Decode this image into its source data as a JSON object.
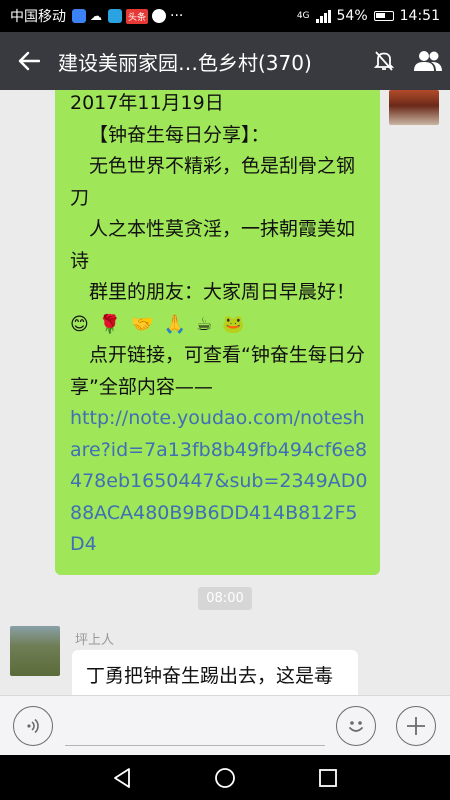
{
  "status_bar": {
    "carrier": "中国移动",
    "network": "4G",
    "battery": "54%",
    "time": "14:51",
    "more": "···",
    "app_badge": "头条"
  },
  "title_bar": {
    "title": "建设美丽家园…色乡村(370)"
  },
  "messages": {
    "my_message": {
      "date_line": "2017年11月19日",
      "heading": "【钟奋生每日分享】：",
      "poem_line1": "无色世界不精彩，色是刮骨之钢刀",
      "poem_line2": "人之本性莫贪淫，一抹朝霞美如诗",
      "greeting": "群里的朋友：大家周日早晨好！",
      "emojis": [
        "😊",
        "🌹",
        "🤝",
        "🙏",
        "☕",
        "🐸"
      ],
      "instruction": "点开链接，可查看“钟奋生每日分享”全部内容——",
      "link": "http://note.youdao.com/noteshare?id=7a13fb8b49fb494cf6e8478eb1650447&sub=2349AD088ACA480B9B6DD414B812F5D4"
    },
    "timestamp": "08:00",
    "other_message": {
      "sender": "坪上人",
      "text": "丁勇把钟奋生踢出去，这是毒"
    }
  },
  "input_bar": {
    "placeholder": ""
  },
  "colors": {
    "my_bubble": "#9fe658",
    "title_bar": "#393a3f",
    "link": "#3f6fb6"
  }
}
